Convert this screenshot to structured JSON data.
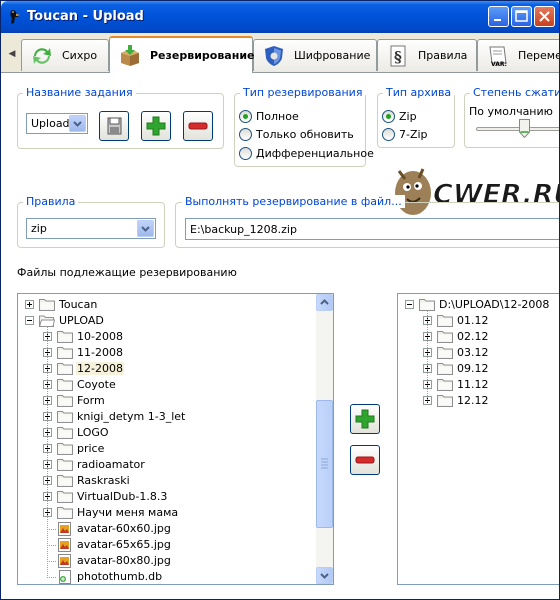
{
  "window": {
    "title": "Toucan - Upload"
  },
  "tabs": [
    {
      "label": "Сихро",
      "icon": "sync-icon"
    },
    {
      "label": "Резервирование",
      "icon": "backup-box-icon",
      "active": true
    },
    {
      "label": "Шифрование",
      "icon": "encrypt-shield-icon"
    },
    {
      "label": "Правила",
      "icon": "rules-icon"
    },
    {
      "label": "Переме",
      "icon": "variables-icon"
    }
  ],
  "job": {
    "title": "Название задания",
    "selected": "Upload"
  },
  "backup_type": {
    "title": "Тип резервирования",
    "options": [
      "Полное",
      "Только обновить",
      "Дифференциальное"
    ],
    "selected": 0
  },
  "archive_type": {
    "title": "Тип архива",
    "options": [
      "Zip",
      "7-Zip"
    ],
    "selected": 0
  },
  "compression": {
    "title": "Степень сжатия",
    "value": "По умолчанию"
  },
  "rules": {
    "title": "Правила",
    "selected": "zip"
  },
  "target": {
    "title": "Выполнять резервирование в файл...",
    "value": "E:\\backup_1208.zip"
  },
  "watermark": "CWER.RU",
  "files_label": "Файлы подлежащие резервированию",
  "source_tree": [
    {
      "label": "Toucan",
      "level": 0,
      "type": "folder",
      "exp": "plus"
    },
    {
      "label": "UPLOAD",
      "level": 0,
      "type": "folder-open",
      "exp": "minus"
    },
    {
      "label": "10-2008",
      "level": 1,
      "type": "folder",
      "exp": "plus"
    },
    {
      "label": "11-2008",
      "level": 1,
      "type": "folder",
      "exp": "plus"
    },
    {
      "label": "12-2008",
      "level": 1,
      "type": "folder",
      "exp": "plus",
      "selected": true
    },
    {
      "label": "Coyote",
      "level": 1,
      "type": "folder",
      "exp": "plus"
    },
    {
      "label": "Form",
      "level": 1,
      "type": "folder",
      "exp": "plus"
    },
    {
      "label": "knigi_detym 1-3_let",
      "level": 1,
      "type": "folder",
      "exp": "plus"
    },
    {
      "label": "LOGO",
      "level": 1,
      "type": "folder",
      "exp": "plus"
    },
    {
      "label": "price",
      "level": 1,
      "type": "folder",
      "exp": "plus"
    },
    {
      "label": "radioamator",
      "level": 1,
      "type": "folder",
      "exp": "plus"
    },
    {
      "label": "Raskraski",
      "level": 1,
      "type": "folder",
      "exp": "plus"
    },
    {
      "label": "VirtualDub-1.8.3",
      "level": 1,
      "type": "folder",
      "exp": "plus"
    },
    {
      "label": "Научи меня мама",
      "level": 1,
      "type": "folder",
      "exp": "plus"
    },
    {
      "label": "avatar-60x60.jpg",
      "level": 1,
      "type": "image"
    },
    {
      "label": "avatar-65x65.jpg",
      "level": 1,
      "type": "image"
    },
    {
      "label": "avatar-80x80.jpg",
      "level": 1,
      "type": "image"
    },
    {
      "label": "photothumb.db",
      "level": 1,
      "type": "db"
    }
  ],
  "target_tree": [
    {
      "label": "D:\\UPLOAD\\12-2008",
      "level": 0,
      "type": "folder",
      "exp": "minus"
    },
    {
      "label": "01.12",
      "level": 1,
      "type": "folder",
      "exp": "plus"
    },
    {
      "label": "02.12",
      "level": 1,
      "type": "folder",
      "exp": "plus"
    },
    {
      "label": "03.12",
      "level": 1,
      "type": "folder",
      "exp": "plus"
    },
    {
      "label": "09.12",
      "level": 1,
      "type": "folder",
      "exp": "plus"
    },
    {
      "label": "11.12",
      "level": 1,
      "type": "folder",
      "exp": "plus"
    },
    {
      "label": "12.12",
      "level": 1,
      "type": "folder",
      "exp": "plus"
    }
  ],
  "colors": {
    "accent": "#0046D5",
    "titlebar": "#0053D9",
    "add": "#2FA52F",
    "remove": "#D62B2B"
  }
}
